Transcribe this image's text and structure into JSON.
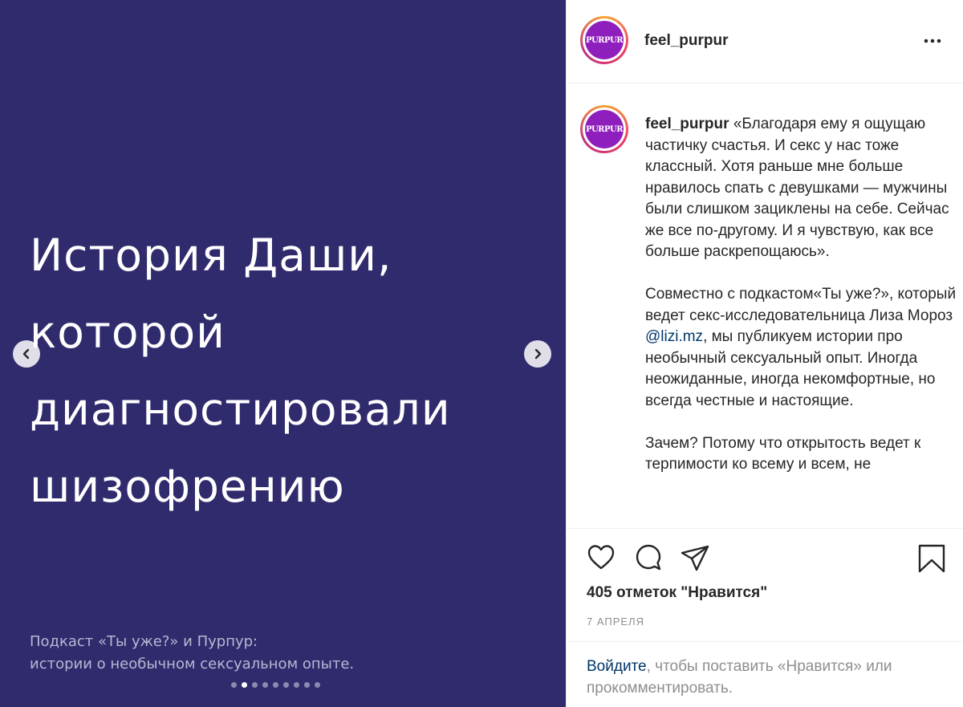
{
  "media": {
    "title": "История Даши,\nкоторой\nдиагностировали\nшизофрению",
    "caption_line1": "Подкаст «Ты уже?» и Пурпур:",
    "caption_line2": "истории о необычном сексуальном опыте.",
    "slide_count": 9,
    "active_slide": 2,
    "background": "#302b6d"
  },
  "header": {
    "avatar_text": "PURPUR",
    "username": "feel_purpur"
  },
  "caption": {
    "username": "feel_purpur",
    "para1": "«Благодаря ему я ощущаю частичку счастья. И секс у нас тоже классный. Хотя раньше мне больше нравилось спать с девушками — мужчины были слишком зациклены на себе. Сейчас же все по-другому. И я чувствую, как все больше раскрепощаюсь».",
    "para2_before": "Совместно с подкастом«Ты уже?», который ведет секс-исследовательница Лиза Мороз",
    "para2_mention": "@lizi.mz",
    "para2_after": ", мы публикуем истории про необычный сексуальный опыт. Иногда неожиданные, иногда некомфортные, но всегда честные и настоящие.",
    "para3": "Зачем? Потому что открытость ведет к терпимости ко всему и всем, не"
  },
  "actions": {
    "likes": "405 отметок \"Нравится\"",
    "date": "7 АПРЕЛЯ",
    "icons": [
      "heart-icon",
      "comment-icon",
      "share-icon",
      "bookmark-icon"
    ]
  },
  "login": {
    "link": "Войдите",
    "text": ", чтобы поставить «Нравится» или прокомментировать."
  },
  "colors": {
    "link": "#00376b",
    "muted": "#8e8e8e",
    "brand_avatar": "#8f1fbd"
  }
}
